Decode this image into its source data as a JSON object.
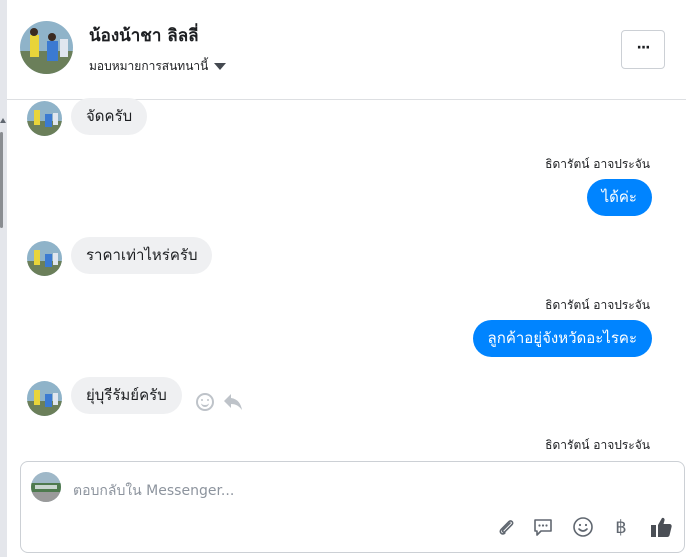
{
  "header": {
    "contact_name": "น้องน้าชา ลิลลี่",
    "assign_label": "มอบหมายการสนทนานี้",
    "more_label": "···"
  },
  "messages": [
    {
      "direction": "in",
      "text": "จัดครับ"
    },
    {
      "direction": "out",
      "sender": "ธิดารัตน์ อาจประจัน",
      "text": "ได้ค่ะ"
    },
    {
      "direction": "in",
      "text": "ราคาเท่าไหร่ครับ"
    },
    {
      "direction": "out",
      "sender": "ธิดารัตน์ อาจประจัน",
      "text": "ลูกค้าอยู่จังหวัดอะไรคะ"
    },
    {
      "direction": "in",
      "text": "ยุ่บุรีรัมย์ครับ"
    },
    {
      "direction": "out",
      "sender": "ธิดารัตน์ อาจประจัน",
      "text": ""
    }
  ],
  "message_actions": [
    "smile-icon",
    "reply-icon"
  ],
  "composer": {
    "placeholder": "ตอบกลับใน Messenger...",
    "value": "",
    "tools": [
      "attachment-icon",
      "saved-reply-icon",
      "emoji-icon",
      "payment-icon",
      "like-icon"
    ],
    "payment_symbol": "฿"
  },
  "colors": {
    "outgoing_bubble": "#0084ff",
    "incoming_bubble": "#eff0f2",
    "like_icon": "#4b4f56"
  }
}
